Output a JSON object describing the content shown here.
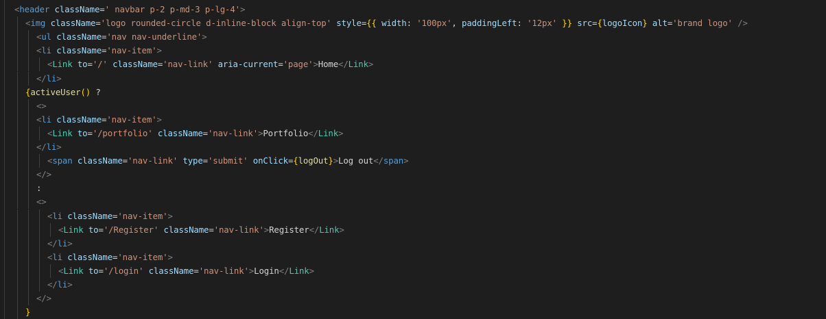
{
  "editor": {
    "colors": {
      "background": "#1e1e1e",
      "punctuation": "#808080",
      "html_tag": "#569cd6",
      "component": "#4ec9b0",
      "attribute": "#9cdcfe",
      "string": "#ce9178",
      "text": "#d4d4d4",
      "brace": "#ffd700",
      "function": "#dcdcaa"
    },
    "lines": [
      {
        "indent": 0,
        "tokens": [
          {
            "t": "punc",
            "v": "<"
          },
          {
            "t": "tag",
            "v": "header"
          },
          {
            "t": "text",
            "v": " "
          },
          {
            "t": "attr",
            "v": "className"
          },
          {
            "t": "text",
            "v": "="
          },
          {
            "t": "str",
            "v": "' navbar p-2 p-md-3 p-lg-4'"
          },
          {
            "t": "punc",
            "v": ">"
          }
        ]
      },
      {
        "indent": 1,
        "tokens": [
          {
            "t": "punc",
            "v": "<"
          },
          {
            "t": "tag",
            "v": "img"
          },
          {
            "t": "text",
            "v": " "
          },
          {
            "t": "attr",
            "v": "className"
          },
          {
            "t": "text",
            "v": "="
          },
          {
            "t": "str",
            "v": "'logo rounded-circle d-inline-block align-top'"
          },
          {
            "t": "text",
            "v": " "
          },
          {
            "t": "attr",
            "v": "style"
          },
          {
            "t": "text",
            "v": "="
          },
          {
            "t": "brace",
            "v": "{{"
          },
          {
            "t": "text",
            "v": " "
          },
          {
            "t": "attr",
            "v": "width"
          },
          {
            "t": "text",
            "v": ": "
          },
          {
            "t": "str",
            "v": "'100px'"
          },
          {
            "t": "text",
            "v": ", "
          },
          {
            "t": "attr",
            "v": "paddingLeft"
          },
          {
            "t": "text",
            "v": ": "
          },
          {
            "t": "str",
            "v": "'12px'"
          },
          {
            "t": "text",
            "v": " "
          },
          {
            "t": "brace",
            "v": "}}"
          },
          {
            "t": "text",
            "v": " "
          },
          {
            "t": "attr",
            "v": "src"
          },
          {
            "t": "text",
            "v": "="
          },
          {
            "t": "brace",
            "v": "{"
          },
          {
            "t": "attr",
            "v": "logoIcon"
          },
          {
            "t": "brace",
            "v": "}"
          },
          {
            "t": "text",
            "v": " "
          },
          {
            "t": "attr",
            "v": "alt"
          },
          {
            "t": "text",
            "v": "="
          },
          {
            "t": "str",
            "v": "'brand logo'"
          },
          {
            "t": "text",
            "v": " "
          },
          {
            "t": "punc",
            "v": "/>"
          }
        ]
      },
      {
        "indent": 2,
        "tokens": [
          {
            "t": "punc",
            "v": "<"
          },
          {
            "t": "tag",
            "v": "ul"
          },
          {
            "t": "text",
            "v": " "
          },
          {
            "t": "attr",
            "v": "className"
          },
          {
            "t": "text",
            "v": "="
          },
          {
            "t": "str",
            "v": "'nav nav-underline'"
          },
          {
            "t": "punc",
            "v": ">"
          }
        ]
      },
      {
        "indent": 2,
        "tokens": [
          {
            "t": "punc",
            "v": "<"
          },
          {
            "t": "tag",
            "v": "li"
          },
          {
            "t": "text",
            "v": " "
          },
          {
            "t": "attr",
            "v": "className"
          },
          {
            "t": "text",
            "v": "="
          },
          {
            "t": "str",
            "v": "'nav-item'"
          },
          {
            "t": "punc",
            "v": ">"
          }
        ]
      },
      {
        "indent": 3,
        "tokens": [
          {
            "t": "punc",
            "v": "<"
          },
          {
            "t": "comp",
            "v": "Link"
          },
          {
            "t": "text",
            "v": " "
          },
          {
            "t": "attr",
            "v": "to"
          },
          {
            "t": "text",
            "v": "="
          },
          {
            "t": "str",
            "v": "'/'"
          },
          {
            "t": "text",
            "v": " "
          },
          {
            "t": "attr",
            "v": "className"
          },
          {
            "t": "text",
            "v": "="
          },
          {
            "t": "str",
            "v": "'nav-link'"
          },
          {
            "t": "text",
            "v": " "
          },
          {
            "t": "attr",
            "v": "aria-current"
          },
          {
            "t": "text",
            "v": "="
          },
          {
            "t": "str",
            "v": "'page'"
          },
          {
            "t": "punc",
            "v": ">"
          },
          {
            "t": "text",
            "v": "Home"
          },
          {
            "t": "punc",
            "v": "</"
          },
          {
            "t": "comp",
            "v": "Link"
          },
          {
            "t": "punc",
            "v": ">"
          }
        ]
      },
      {
        "indent": 2,
        "tokens": [
          {
            "t": "punc",
            "v": "</"
          },
          {
            "t": "tag",
            "v": "li"
          },
          {
            "t": "punc",
            "v": ">"
          }
        ]
      },
      {
        "indent": 1,
        "tokens": [
          {
            "t": "brace",
            "v": "{"
          },
          {
            "t": "fn",
            "v": "activeUser"
          },
          {
            "t": "brace",
            "v": "()"
          },
          {
            "t": "text",
            "v": " ?"
          }
        ]
      },
      {
        "indent": 2,
        "tokens": [
          {
            "t": "punc",
            "v": "<>"
          }
        ]
      },
      {
        "indent": 2,
        "tokens": [
          {
            "t": "punc",
            "v": "<"
          },
          {
            "t": "tag",
            "v": "li"
          },
          {
            "t": "text",
            "v": " "
          },
          {
            "t": "attr",
            "v": "className"
          },
          {
            "t": "text",
            "v": "="
          },
          {
            "t": "str",
            "v": "'nav-item'"
          },
          {
            "t": "punc",
            "v": ">"
          }
        ]
      },
      {
        "indent": 3,
        "tokens": [
          {
            "t": "punc",
            "v": "<"
          },
          {
            "t": "comp",
            "v": "Link"
          },
          {
            "t": "text",
            "v": " "
          },
          {
            "t": "attr",
            "v": "to"
          },
          {
            "t": "text",
            "v": "="
          },
          {
            "t": "str",
            "v": "'/portfolio'"
          },
          {
            "t": "text",
            "v": " "
          },
          {
            "t": "attr",
            "v": "className"
          },
          {
            "t": "text",
            "v": "="
          },
          {
            "t": "str",
            "v": "'nav-link'"
          },
          {
            "t": "punc",
            "v": ">"
          },
          {
            "t": "text",
            "v": "Portfolio"
          },
          {
            "t": "punc",
            "v": "</"
          },
          {
            "t": "comp",
            "v": "Link"
          },
          {
            "t": "punc",
            "v": ">"
          }
        ]
      },
      {
        "indent": 2,
        "tokens": [
          {
            "t": "punc",
            "v": "</"
          },
          {
            "t": "tag",
            "v": "li"
          },
          {
            "t": "punc",
            "v": ">"
          }
        ]
      },
      {
        "indent": 3,
        "tokens": [
          {
            "t": "punc",
            "v": "<"
          },
          {
            "t": "tag",
            "v": "span"
          },
          {
            "t": "text",
            "v": " "
          },
          {
            "t": "attr",
            "v": "className"
          },
          {
            "t": "text",
            "v": "="
          },
          {
            "t": "str",
            "v": "'nav-link'"
          },
          {
            "t": "text",
            "v": " "
          },
          {
            "t": "attr",
            "v": "type"
          },
          {
            "t": "text",
            "v": "="
          },
          {
            "t": "str",
            "v": "'submit'"
          },
          {
            "t": "text",
            "v": " "
          },
          {
            "t": "attr",
            "v": "onClick"
          },
          {
            "t": "text",
            "v": "="
          },
          {
            "t": "brace",
            "v": "{"
          },
          {
            "t": "fn",
            "v": "logOut"
          },
          {
            "t": "brace",
            "v": "}"
          },
          {
            "t": "punc",
            "v": ">"
          },
          {
            "t": "text",
            "v": "Log out"
          },
          {
            "t": "punc",
            "v": "</"
          },
          {
            "t": "tag",
            "v": "span"
          },
          {
            "t": "punc",
            "v": ">"
          }
        ]
      },
      {
        "indent": 2,
        "tokens": [
          {
            "t": "punc",
            "v": "</>"
          }
        ]
      },
      {
        "indent": 2,
        "tokens": [
          {
            "t": "text",
            "v": ":"
          }
        ]
      },
      {
        "indent": 2,
        "tokens": [
          {
            "t": "punc",
            "v": "<>"
          }
        ]
      },
      {
        "indent": 3,
        "tokens": [
          {
            "t": "punc",
            "v": "<"
          },
          {
            "t": "tag",
            "v": "li"
          },
          {
            "t": "text",
            "v": " "
          },
          {
            "t": "attr",
            "v": "className"
          },
          {
            "t": "text",
            "v": "="
          },
          {
            "t": "str",
            "v": "'nav-item'"
          },
          {
            "t": "punc",
            "v": ">"
          }
        ]
      },
      {
        "indent": 4,
        "tokens": [
          {
            "t": "punc",
            "v": "<"
          },
          {
            "t": "comp",
            "v": "Link"
          },
          {
            "t": "text",
            "v": " "
          },
          {
            "t": "attr",
            "v": "to"
          },
          {
            "t": "text",
            "v": "="
          },
          {
            "t": "str",
            "v": "'/Register'"
          },
          {
            "t": "text",
            "v": " "
          },
          {
            "t": "attr",
            "v": "className"
          },
          {
            "t": "text",
            "v": "="
          },
          {
            "t": "str",
            "v": "'nav-link'"
          },
          {
            "t": "punc",
            "v": ">"
          },
          {
            "t": "text",
            "v": "Register"
          },
          {
            "t": "punc",
            "v": "</"
          },
          {
            "t": "comp",
            "v": "Link"
          },
          {
            "t": "punc",
            "v": ">"
          }
        ]
      },
      {
        "indent": 3,
        "tokens": [
          {
            "t": "punc",
            "v": "</"
          },
          {
            "t": "tag",
            "v": "li"
          },
          {
            "t": "punc",
            "v": ">"
          }
        ]
      },
      {
        "indent": 3,
        "tokens": [
          {
            "t": "punc",
            "v": "<"
          },
          {
            "t": "tag",
            "v": "li"
          },
          {
            "t": "text",
            "v": " "
          },
          {
            "t": "attr",
            "v": "className"
          },
          {
            "t": "text",
            "v": "="
          },
          {
            "t": "str",
            "v": "'nav-item'"
          },
          {
            "t": "punc",
            "v": ">"
          }
        ]
      },
      {
        "indent": 4,
        "tokens": [
          {
            "t": "punc",
            "v": "<"
          },
          {
            "t": "comp",
            "v": "Link"
          },
          {
            "t": "text",
            "v": " "
          },
          {
            "t": "attr",
            "v": "to"
          },
          {
            "t": "text",
            "v": "="
          },
          {
            "t": "str",
            "v": "'/login'"
          },
          {
            "t": "text",
            "v": " "
          },
          {
            "t": "attr",
            "v": "className"
          },
          {
            "t": "text",
            "v": "="
          },
          {
            "t": "str",
            "v": "'nav-link'"
          },
          {
            "t": "punc",
            "v": ">"
          },
          {
            "t": "text",
            "v": "Login"
          },
          {
            "t": "punc",
            "v": "</"
          },
          {
            "t": "comp",
            "v": "Link"
          },
          {
            "t": "punc",
            "v": ">"
          }
        ]
      },
      {
        "indent": 3,
        "tokens": [
          {
            "t": "punc",
            "v": "</"
          },
          {
            "t": "tag",
            "v": "li"
          },
          {
            "t": "punc",
            "v": ">"
          }
        ]
      },
      {
        "indent": 2,
        "tokens": [
          {
            "t": "punc",
            "v": "</>"
          }
        ]
      },
      {
        "indent": 1,
        "tokens": [
          {
            "t": "brace",
            "v": "}"
          }
        ]
      }
    ]
  }
}
